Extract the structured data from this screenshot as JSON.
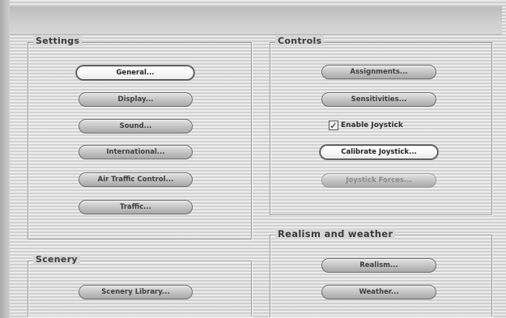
{
  "settings": {
    "title": "Settings",
    "buttons": {
      "general": "General...",
      "display": "Display...",
      "sound": "Sound...",
      "international": "International...",
      "atc": "Air Traffic Control...",
      "traffic": "Traffic..."
    }
  },
  "controls": {
    "title": "Controls",
    "buttons": {
      "assignments": "Assignments...",
      "sensitivities": "Sensitivities...",
      "calibrate": "Calibrate Joystick...",
      "forces": "Joystick Forces..."
    },
    "joystick_checkbox": {
      "label": "Enable Joystick",
      "checked": true,
      "mark": "✓"
    }
  },
  "realism": {
    "title": "Realism and weather",
    "buttons": {
      "realism": "Realism...",
      "weather": "Weather..."
    }
  },
  "scenery": {
    "title": "Scenery",
    "buttons": {
      "library": "Scenery Library..."
    }
  }
}
